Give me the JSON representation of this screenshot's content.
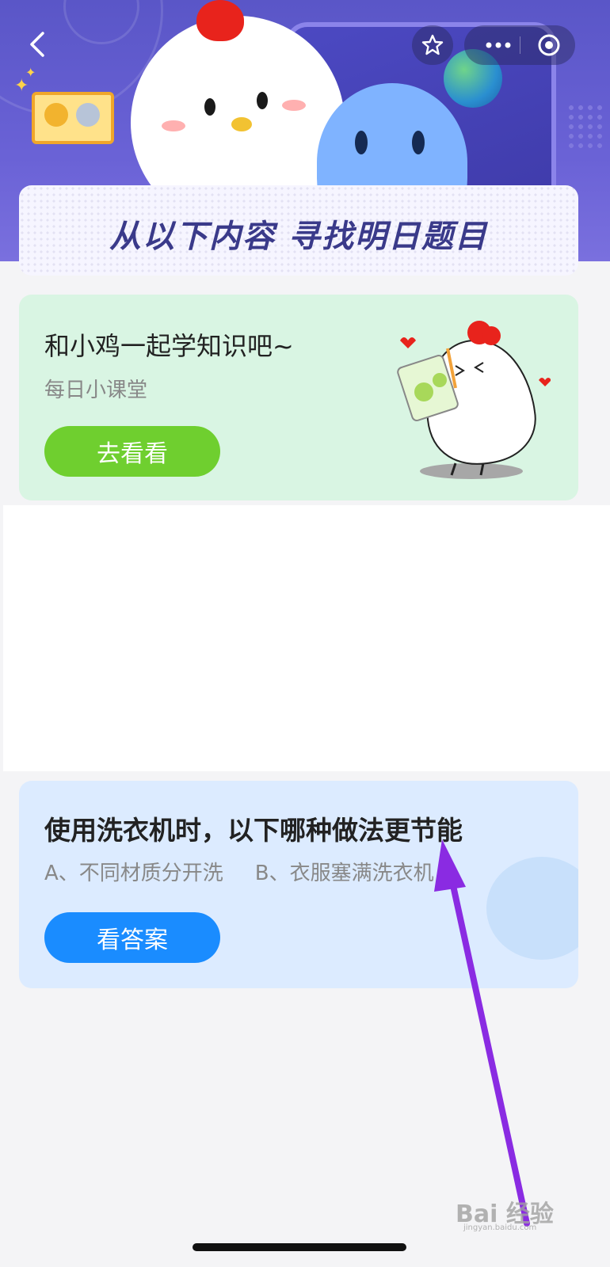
{
  "header": {
    "banner_title": "从以下内容 寻找明日题目",
    "icons": [
      "back-icon",
      "star-icon",
      "more-icon",
      "target-icon"
    ]
  },
  "lesson_card": {
    "title": "和小鸡一起学知识吧~",
    "subtitle": "每日小课堂",
    "button_label": "去看看"
  },
  "question_card": {
    "question": "使用洗衣机时，以下哪种做法更节能",
    "option_a": "A、不同材质分开洗",
    "option_b": "B、衣服塞满洗衣机",
    "button_label": "看答案"
  },
  "watermark": {
    "text": "Bai 经验",
    "sub": "jingyan.baidu.com"
  },
  "colors": {
    "header_bg": "#5a56c7",
    "green_card": "#d9f5e3",
    "green_button": "#6fcf2f",
    "blue_card": "#dcebff",
    "blue_button": "#1a8cff",
    "annotation_arrow": "#8a2be2"
  }
}
